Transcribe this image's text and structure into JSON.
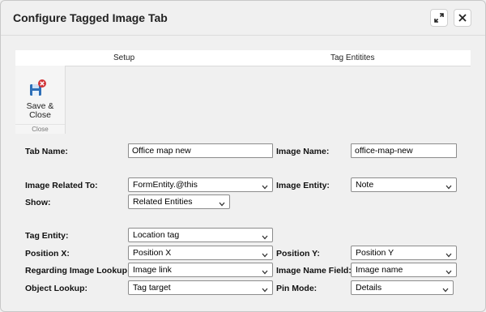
{
  "dialog": {
    "title": "Configure Tagged Image Tab"
  },
  "tabs": [
    {
      "label": "Setup"
    },
    {
      "label": "Tag Entitites"
    }
  ],
  "ribbon": {
    "save_label_line1": "Save &",
    "save_label_line2": "Close",
    "group_label": "Close"
  },
  "form": {
    "tab_name": {
      "label": "Tab Name:",
      "value": "Office map new"
    },
    "image_name": {
      "label": "Image Name:",
      "value": "office-map-new"
    },
    "image_related_to": {
      "label": "Image Related To:",
      "value": "FormEntity.@this"
    },
    "image_entity": {
      "label": "Image Entity:",
      "value": "Note"
    },
    "show": {
      "label": "Show:",
      "value": "Related Entities"
    },
    "tag_entity": {
      "label": "Tag Entity:",
      "value": "Location tag"
    },
    "position_x": {
      "label": "Position X:",
      "value": "Position X"
    },
    "position_y": {
      "label": "Position Y:",
      "value": "Position Y"
    },
    "regarding_image_lookup": {
      "label": "Regarding Image Lookup:",
      "value": "Image link"
    },
    "image_name_field": {
      "label": "Image Name Field:",
      "value": "Image name"
    },
    "object_lookup": {
      "label": "Object Lookup:",
      "value": "Tag target"
    },
    "pin_mode": {
      "label": "Pin Mode:",
      "value": "Details"
    }
  },
  "colors": {
    "save_icon_blue": "#2e6fb7",
    "close_badge_red": "#d13438"
  },
  "icons": {
    "expand": "expand-icon",
    "close": "close-icon",
    "save": "save-close-icon",
    "dropdown": "chevron-down-icon"
  }
}
